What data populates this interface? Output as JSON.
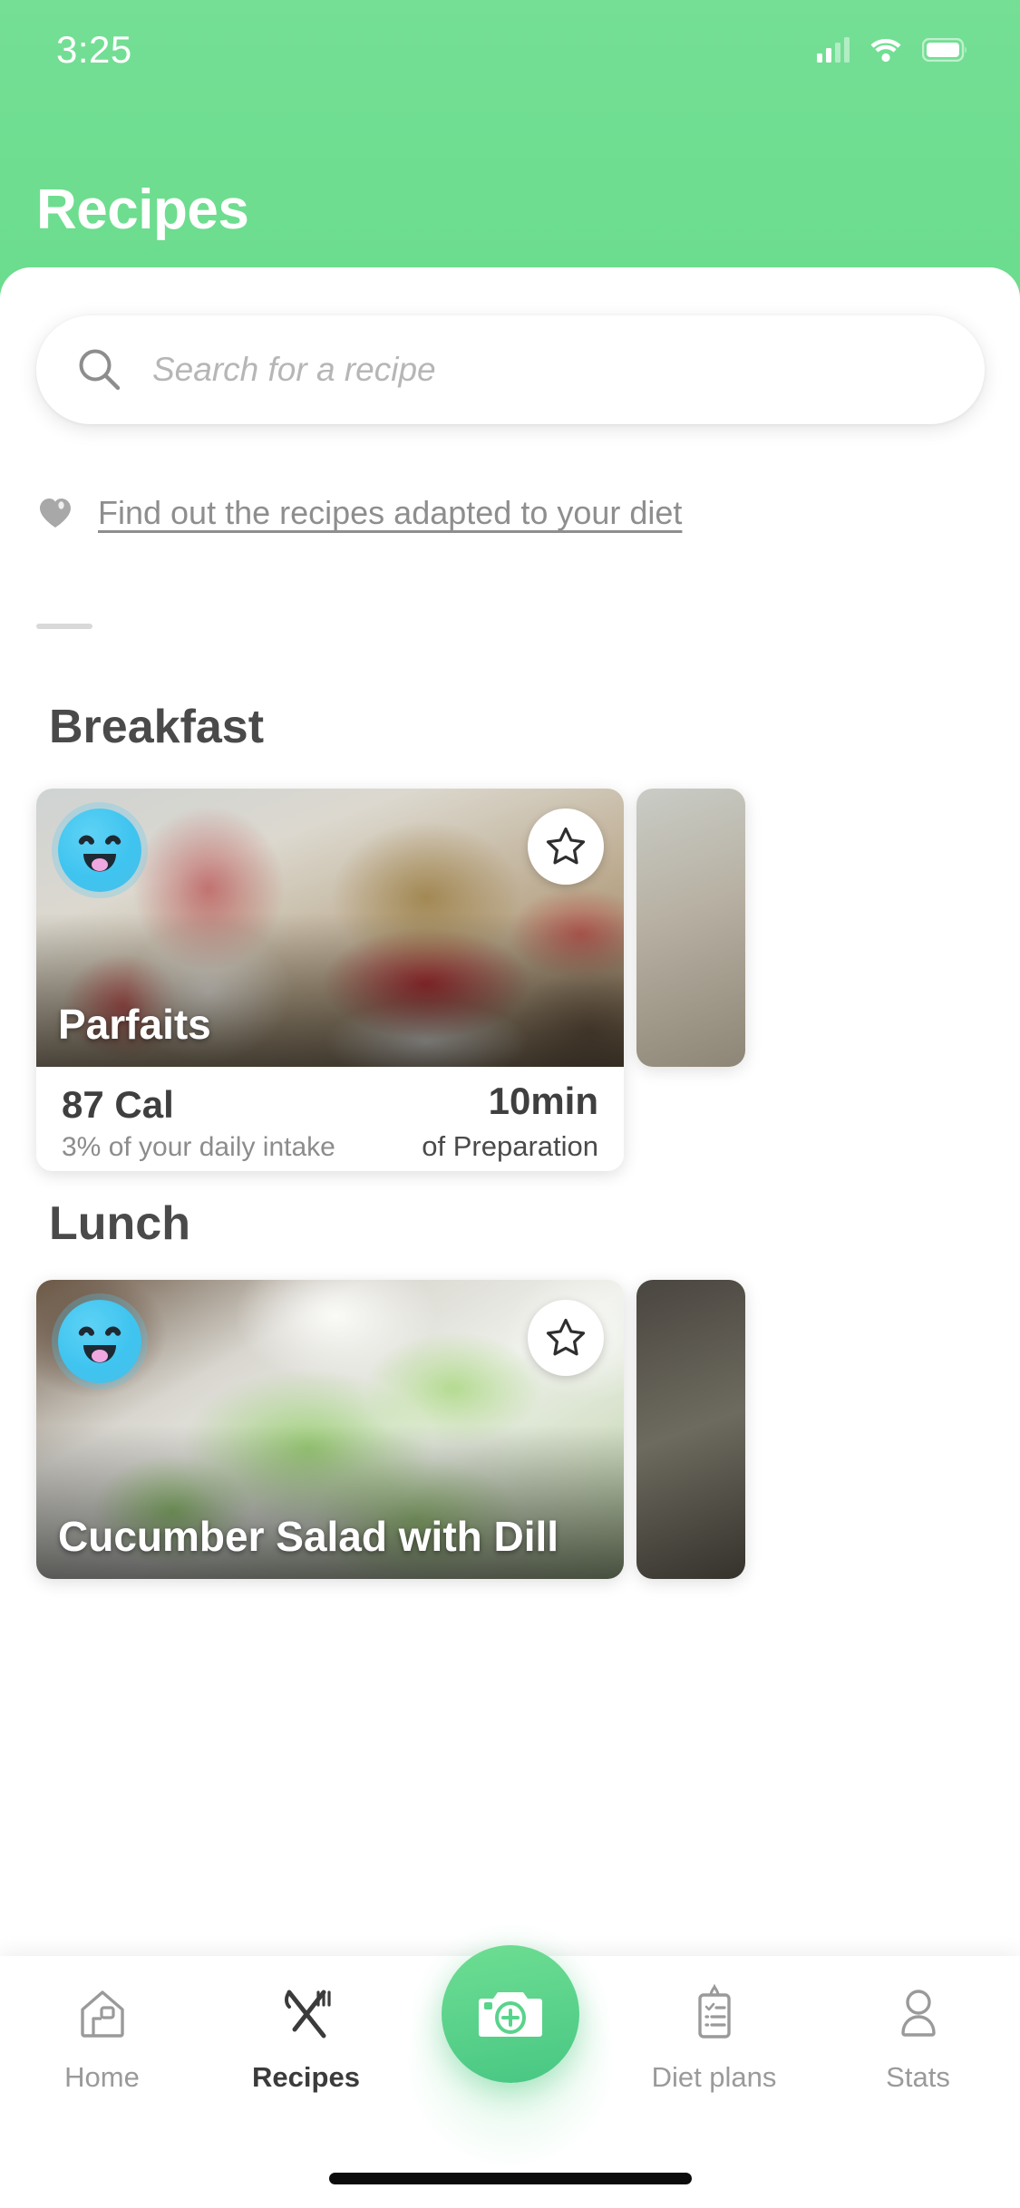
{
  "status_bar": {
    "time": "3:25",
    "cellular_icon": "signal-bars-icon",
    "wifi_icon": "wifi-icon",
    "battery_icon": "battery-icon"
  },
  "header": {
    "title": "Recipes",
    "background_color": "#6EDD8E"
  },
  "search": {
    "placeholder": "Search for a recipe",
    "icon": "search-icon",
    "value": ""
  },
  "diet_link": {
    "icon": "heart-icon",
    "label": "Find out the recipes adapted to your diet"
  },
  "sections": [
    {
      "title": "Breakfast",
      "cards": [
        {
          "name": "Parfaits",
          "badge_icon": "smiley-face-icon",
          "favorite_icon": "star-outline-icon",
          "calories": "87 Cal",
          "daily_intake": "3%  of your daily intake",
          "time": "10min",
          "time_caption": "of Preparation"
        }
      ]
    },
    {
      "title": "Lunch",
      "cards": [
        {
          "name": "Cucumber Salad with Dill",
          "badge_icon": "smiley-face-icon",
          "favorite_icon": "star-outline-icon"
        }
      ]
    }
  ],
  "tabbar": {
    "items": [
      {
        "label": "Home",
        "icon": "house-icon",
        "active": false
      },
      {
        "label": "Recipes",
        "icon": "fork-knife-icon",
        "active": true
      },
      {
        "label": "Diet plans",
        "icon": "clipboard-icon",
        "active": false
      },
      {
        "label": "Stats",
        "icon": "person-icon",
        "active": false
      }
    ],
    "fab": {
      "icon": "camera-plus-icon",
      "color": "#58D48B"
    }
  }
}
